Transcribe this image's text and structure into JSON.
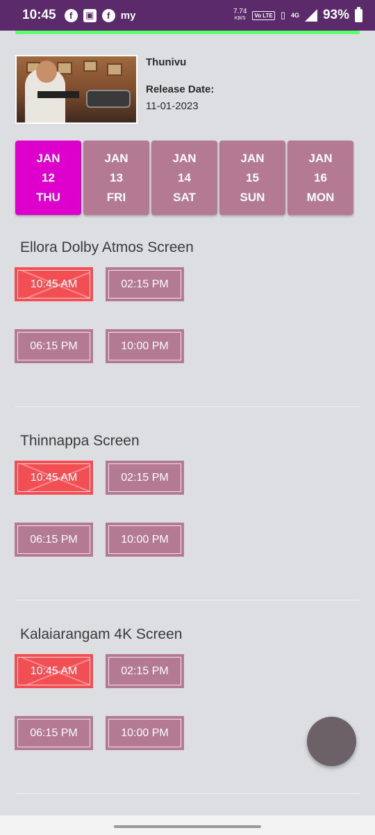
{
  "status_bar": {
    "time": "10:45",
    "net_speed_value": "7.74",
    "net_speed_unit": "KB/S",
    "volte": "Vo LTE",
    "network": "4G",
    "battery": "93%"
  },
  "movie": {
    "title": "Thunivu",
    "release_label": "Release Date:",
    "release_date": "11-01-2023"
  },
  "dates": [
    {
      "month": "JAN",
      "day": "12",
      "weekday": "THU",
      "selected": true
    },
    {
      "month": "JAN",
      "day": "13",
      "weekday": "FRI",
      "selected": false
    },
    {
      "month": "JAN",
      "day": "14",
      "weekday": "SAT",
      "selected": false
    },
    {
      "month": "JAN",
      "day": "15",
      "weekday": "SUN",
      "selected": false
    },
    {
      "month": "JAN",
      "day": "16",
      "weekday": "MON",
      "selected": false
    }
  ],
  "screens": [
    {
      "name": "Ellora Dolby Atmos Screen",
      "shows": [
        {
          "time": "10:45 AM",
          "status": "unavailable"
        },
        {
          "time": "02:15 PM",
          "status": "available"
        },
        {
          "time": "06:15 PM",
          "status": "available"
        },
        {
          "time": "10:00 PM",
          "status": "available"
        }
      ]
    },
    {
      "name": "Thinnappa Screen",
      "shows": [
        {
          "time": "10:45 AM",
          "status": "unavailable"
        },
        {
          "time": "02:15 PM",
          "status": "available"
        },
        {
          "time": "06:15 PM",
          "status": "available"
        },
        {
          "time": "10:00 PM",
          "status": "available"
        }
      ]
    },
    {
      "name": "Kalaiarangam 4K Screen",
      "shows": [
        {
          "time": "10:45 AM",
          "status": "unavailable"
        },
        {
          "time": "02:15 PM",
          "status": "available"
        },
        {
          "time": "06:15 PM",
          "status": "available"
        },
        {
          "time": "10:00 PM",
          "status": "available"
        }
      ]
    }
  ],
  "colors": {
    "status_bar": "#5a2a6b",
    "progress": "#5dff6a",
    "date_tab": "#b47a93",
    "date_tab_selected": "#dd00cc",
    "show_available": "#b47a93",
    "show_unavailable": "#f24f55",
    "fab": "#6c6166",
    "background": "#dcdee1"
  },
  "icons": [
    "facebook-icon",
    "clapperboard-icon",
    "facebook-icon",
    "myntra-icon",
    "vibrate-icon",
    "signal-icon",
    "battery-icon"
  ]
}
